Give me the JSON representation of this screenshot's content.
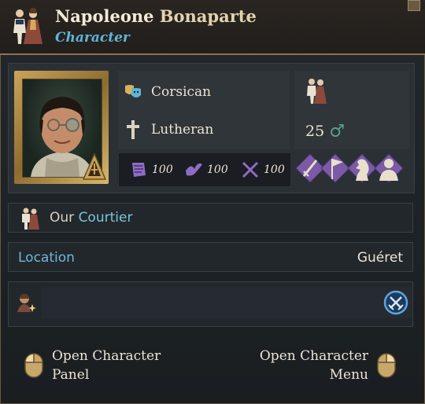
{
  "header": {
    "first_name": "Napoleone",
    "last_name": "Bonaparte",
    "subtitle": "Character"
  },
  "info": {
    "culture": "Corsican",
    "religion": "Lutheran",
    "age": "25",
    "gender_symbol": "♂"
  },
  "skills": [
    {
      "name": "administrative",
      "value": "100",
      "icon": "scroll-icon"
    },
    {
      "name": "diplomatic",
      "value": "100",
      "icon": "dove-icon"
    },
    {
      "name": "military",
      "value": "100",
      "icon": "crossed-swords-icon"
    }
  ],
  "traits": [
    "sword-trait-icon",
    "flag-trait-icon",
    "knight-trait-icon",
    "bust-trait-icon"
  ],
  "courtier": {
    "prefix": "Our",
    "role": "Courtier"
  },
  "location": {
    "label": "Location",
    "value": "Guéret"
  },
  "footer": {
    "left_line1": "Open Character",
    "left_line2": "Panel",
    "right_line1": "Open Character",
    "right_line2": "Menu"
  },
  "colors": {
    "accent_blue": "#5fb6d9",
    "gold": "#caa45a",
    "trait_purple": "#7b5aa6"
  }
}
